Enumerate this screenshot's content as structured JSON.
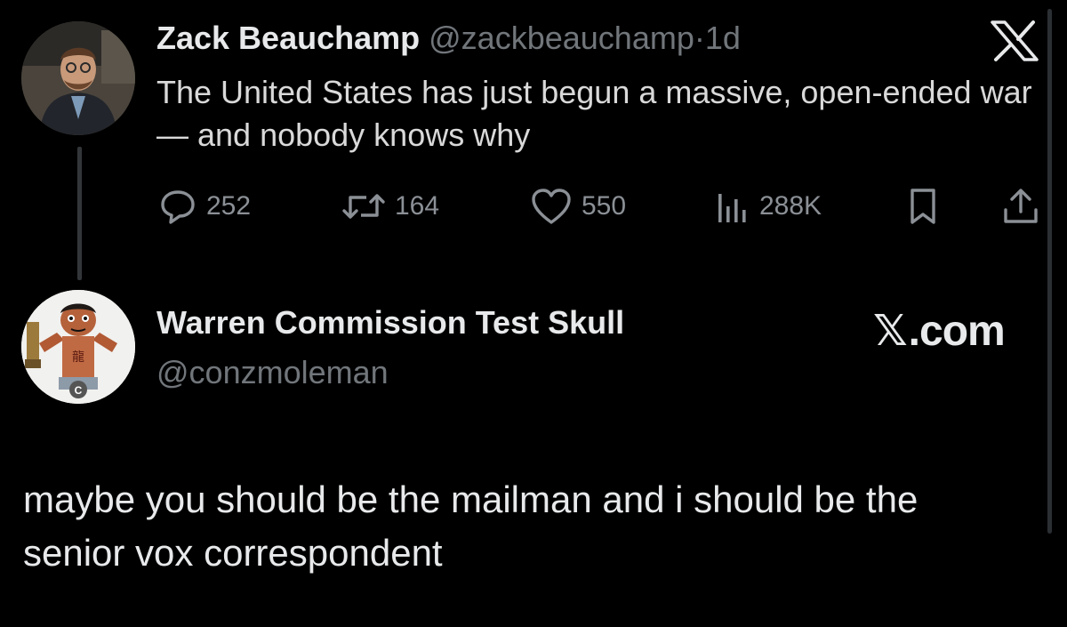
{
  "quoted_tweet": {
    "display_name": "Zack Beauchamp",
    "handle": "@zackbeauchamp",
    "separator": "·",
    "time_ago": "1d",
    "text": "The United States has just begun a massive, open-ended war — and nobody knows why",
    "actions": {
      "replies": "252",
      "retweets": "164",
      "likes": "550",
      "views": "288K"
    },
    "platform_icon": "x-logo"
  },
  "reply": {
    "display_name": "Warren Commission Test Skull",
    "handle": "@conzmoleman",
    "brand_mark": "𝕏",
    "brand_suffix": ".com",
    "text": "maybe you should be the mailman and i should be the senior vox correspondent"
  },
  "colors": {
    "background": "#000000",
    "text_primary": "#e7e9ea",
    "text_muted": "#71767b",
    "thread_line": "#333639"
  }
}
